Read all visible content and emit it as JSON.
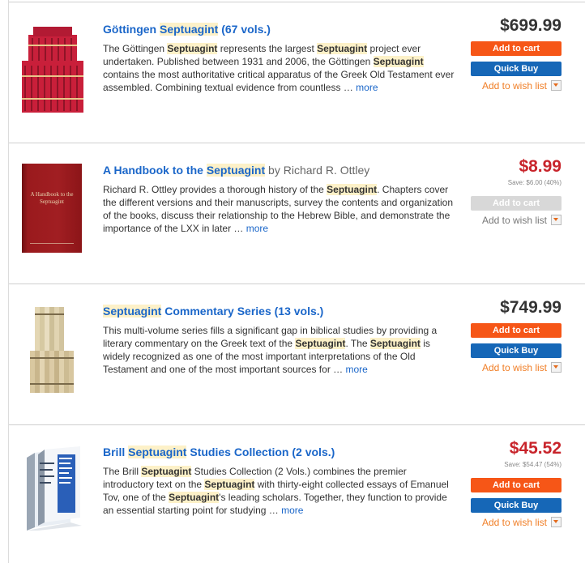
{
  "products": [
    {
      "title_pre": "Göttingen ",
      "title_hl": "Septuagint",
      "title_post": " (67 vols.)",
      "author": "",
      "desc": [
        {
          "t": "The Göttingen "
        },
        {
          "t": "Septuagint",
          "hl": true
        },
        {
          "t": " represents the largest "
        },
        {
          "t": "Septuagint",
          "hl": true
        },
        {
          "t": " project ever undertaken. Published between 1931 and 2006, the Göttingen "
        },
        {
          "t": "Septuagint",
          "hl": true
        },
        {
          "t": " contains the most authoritative critical apparatus of the Greek Old Testament ever assembled. Combining textual evidence from countless … "
        }
      ],
      "more": "more",
      "price": "$699.99",
      "save": "",
      "cart": "Add to cart",
      "quick": "Quick Buy",
      "wish": "Add to wish list"
    },
    {
      "title_pre": "A Handbook to the ",
      "title_hl": "Septuagint",
      "title_post": "",
      "author": " by Richard R. Ottley",
      "desc": [
        {
          "t": "Richard R. Ottley provides a thorough history of the "
        },
        {
          "t": "Septuagint",
          "hl": true
        },
        {
          "t": ". Chapters cover the different versions and their manuscripts, survey the contents and organization of the books, discuss their relationship to the Hebrew Bible, and demonstrate the importance of the LXX in later … "
        }
      ],
      "more": "more",
      "price": "$8.99",
      "save": "Save: $6.00 (40%)",
      "cart": "Add to cart",
      "quick": "",
      "wish": "Add to wish list",
      "book_cover": "A Handbook to the Septuagint"
    },
    {
      "title_pre": "",
      "title_hl": "Septuagint",
      "title_post": " Commentary Series (13 vols.)",
      "author": "",
      "desc": [
        {
          "t": "This multi-volume series fills a significant gap in biblical studies by providing a literary commentary on the Greek text of the "
        },
        {
          "t": "Septuagint",
          "hl": true
        },
        {
          "t": ". The "
        },
        {
          "t": "Septuagint",
          "hl": true
        },
        {
          "t": " is widely recognized as one of the most important interpretations of the Old Testament and one of the most important sources for … "
        }
      ],
      "more": "more",
      "price": "$749.99",
      "save": "",
      "cart": "Add to cart",
      "quick": "Quick Buy",
      "wish": "Add to wish list"
    },
    {
      "title_pre": "Brill ",
      "title_hl": "Septuagint",
      "title_post": " Studies Collection (2 vols.)",
      "author": "",
      "desc": [
        {
          "t": "The Brill "
        },
        {
          "t": "Septuagint",
          "hl": true
        },
        {
          "t": " Studies Collection (2 Vols.) combines the premier introductory text on the "
        },
        {
          "t": "Septuagint",
          "hl": true
        },
        {
          "t": " with thirty-eight collected essays of Emanuel Tov, one of the "
        },
        {
          "t": "Septuagint",
          "hl": true
        },
        {
          "t": "'s leading scholars. Together, they function to provide an essential starting point for studying … "
        }
      ],
      "more": "more",
      "price": "$45.52",
      "save": "Save: $54.47 (54%)",
      "cart": "Add to cart",
      "quick": "Quick Buy",
      "wish": "Add to wish list"
    }
  ],
  "colors": {
    "link": "#1a66c9",
    "cart": "#f65617",
    "quick": "#1667b7",
    "sale_price": "#c8242b",
    "wish": "#f07e26",
    "highlight": "#fdf1c8"
  },
  "icons": [
    "dropdown-arrow-icon",
    "book-set-thumbnail",
    "book-cover-thumbnail"
  ]
}
